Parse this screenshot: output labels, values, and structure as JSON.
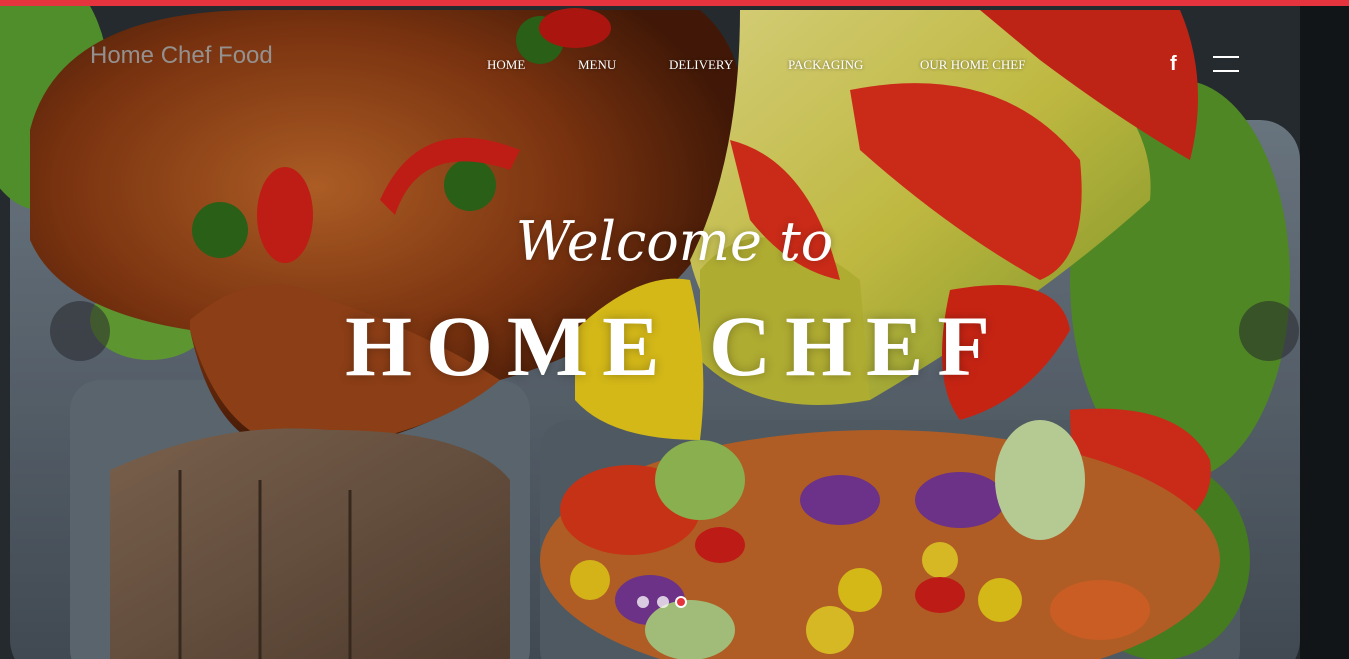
{
  "brand": {
    "name": "Home Chef Food"
  },
  "nav": {
    "items": [
      {
        "label": "HOME"
      },
      {
        "label": "MENU"
      },
      {
        "label": "DELIVERY"
      },
      {
        "label": "PACKAGING"
      },
      {
        "label": "OUR HOME CHEF"
      }
    ],
    "social_icon": "f"
  },
  "hero": {
    "welcome": "Welcome to",
    "title": "HOME CHEF"
  },
  "carousel": {
    "prev_icon": "chevron-left-icon",
    "next_icon": "chevron-right-icon",
    "prev_glyph": "",
    "next_glyph": "",
    "slide_count": 3,
    "active_slide": 3
  },
  "colors": {
    "accent": "#e5343d",
    "text": "#ffffff"
  }
}
